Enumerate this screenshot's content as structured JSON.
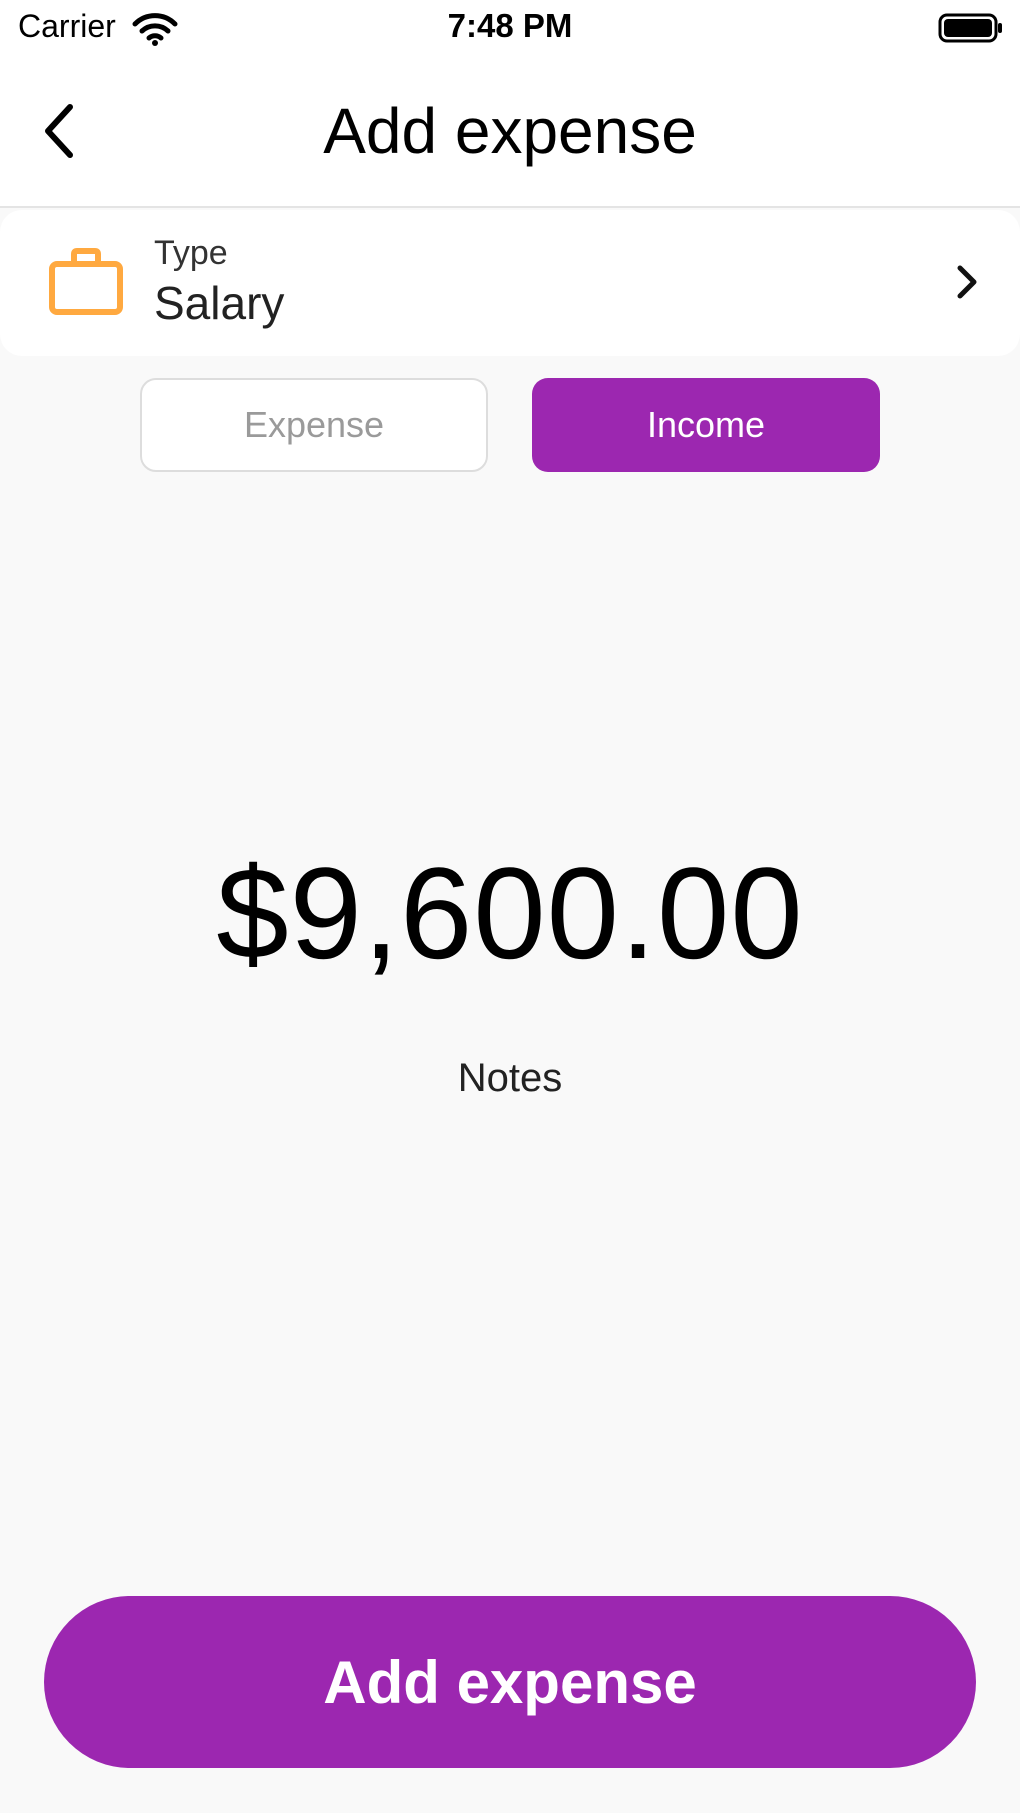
{
  "status_bar": {
    "carrier": "Carrier",
    "time": "7:48 PM",
    "wifi_icon": "wifi-icon",
    "battery_icon": "battery-icon"
  },
  "nav": {
    "back_icon": "chevron-left-icon",
    "title": "Add expense"
  },
  "type_selector": {
    "icon": "briefcase-icon",
    "icon_color": "#ffa940",
    "label": "Type",
    "value": "Salary",
    "chevron_icon": "chevron-right-icon"
  },
  "segments": {
    "expense_label": "Expense",
    "income_label": "Income",
    "selected": "Income",
    "accent_color": "#9c27b0"
  },
  "amount": {
    "value": "$9,600.00"
  },
  "notes": {
    "placeholder": "Notes"
  },
  "submit": {
    "label": "Add expense",
    "color": "#9c27b0"
  }
}
